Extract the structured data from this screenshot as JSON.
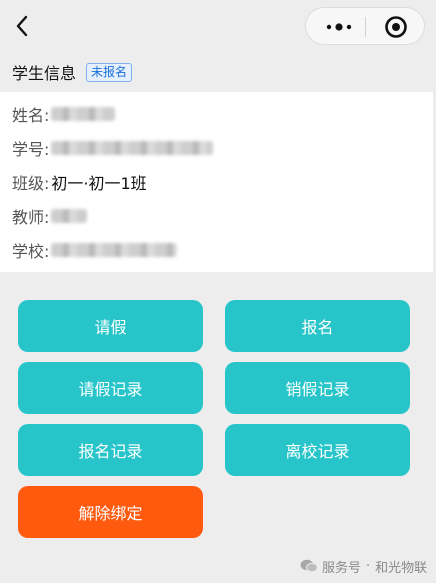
{
  "nav": {
    "back_icon": "chevron-left-icon",
    "more_icon": "more-dots-icon",
    "close_icon": "target-icon"
  },
  "section": {
    "title": "学生信息",
    "badge": "未报名"
  },
  "info": {
    "name_label": "姓名:",
    "id_label": "学号:",
    "class_label": "班级:",
    "class_value": "初一·初一1班",
    "teacher_label": "教师:",
    "school_label": "学校:"
  },
  "buttons": {
    "leave": "请假",
    "signup": "报名",
    "leave_records": "请假记录",
    "cancel_leave_records": "销假记录",
    "signup_records": "报名记录",
    "leave_school_records": "离校记录",
    "unbind": "解除绑定"
  },
  "footer": {
    "service": "服务号",
    "separator": "·",
    "brand": "和光物联"
  },
  "colors": {
    "primary": "#27c5c9",
    "danger": "#ff5a0e",
    "badge": "#1a6fd6",
    "background": "#ededed"
  }
}
